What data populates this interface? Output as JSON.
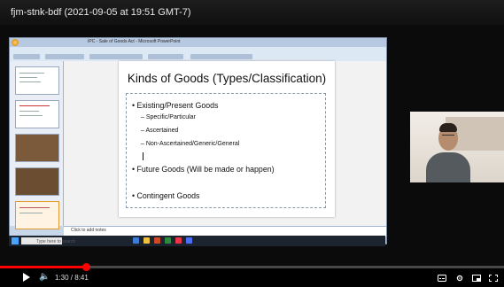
{
  "video": {
    "title": "fjm-stnk-bdf (2021-09-05 at 19:51 GMT-7)",
    "time": "1:30 / 8:41",
    "progress_fraction": 0.17
  },
  "powerpoint": {
    "window_title": "IPC - Sale of Goods Act - Microsoft PowerPoint",
    "notes_placeholder": "Click to add notes"
  },
  "slide": {
    "title": "Kinds of Goods (Types/Classification)",
    "bullets": {
      "existing": "Existing/Present Goods",
      "specific": "Specific/Particular",
      "ascertained": "Ascertained",
      "non_ascertained": "Non-Ascertained/Generic/General",
      "future": "Future Goods (Will be made or happen)",
      "contingent": "Contingent Goods"
    }
  },
  "taskbar": {
    "search_placeholder": "Type here to search"
  },
  "icons": [
    "play-icon",
    "volume-icon",
    "subtitles-icon",
    "settings-icon",
    "miniplayer-icon",
    "fullscreen-icon",
    "windows-start-icon",
    "search-icon"
  ]
}
